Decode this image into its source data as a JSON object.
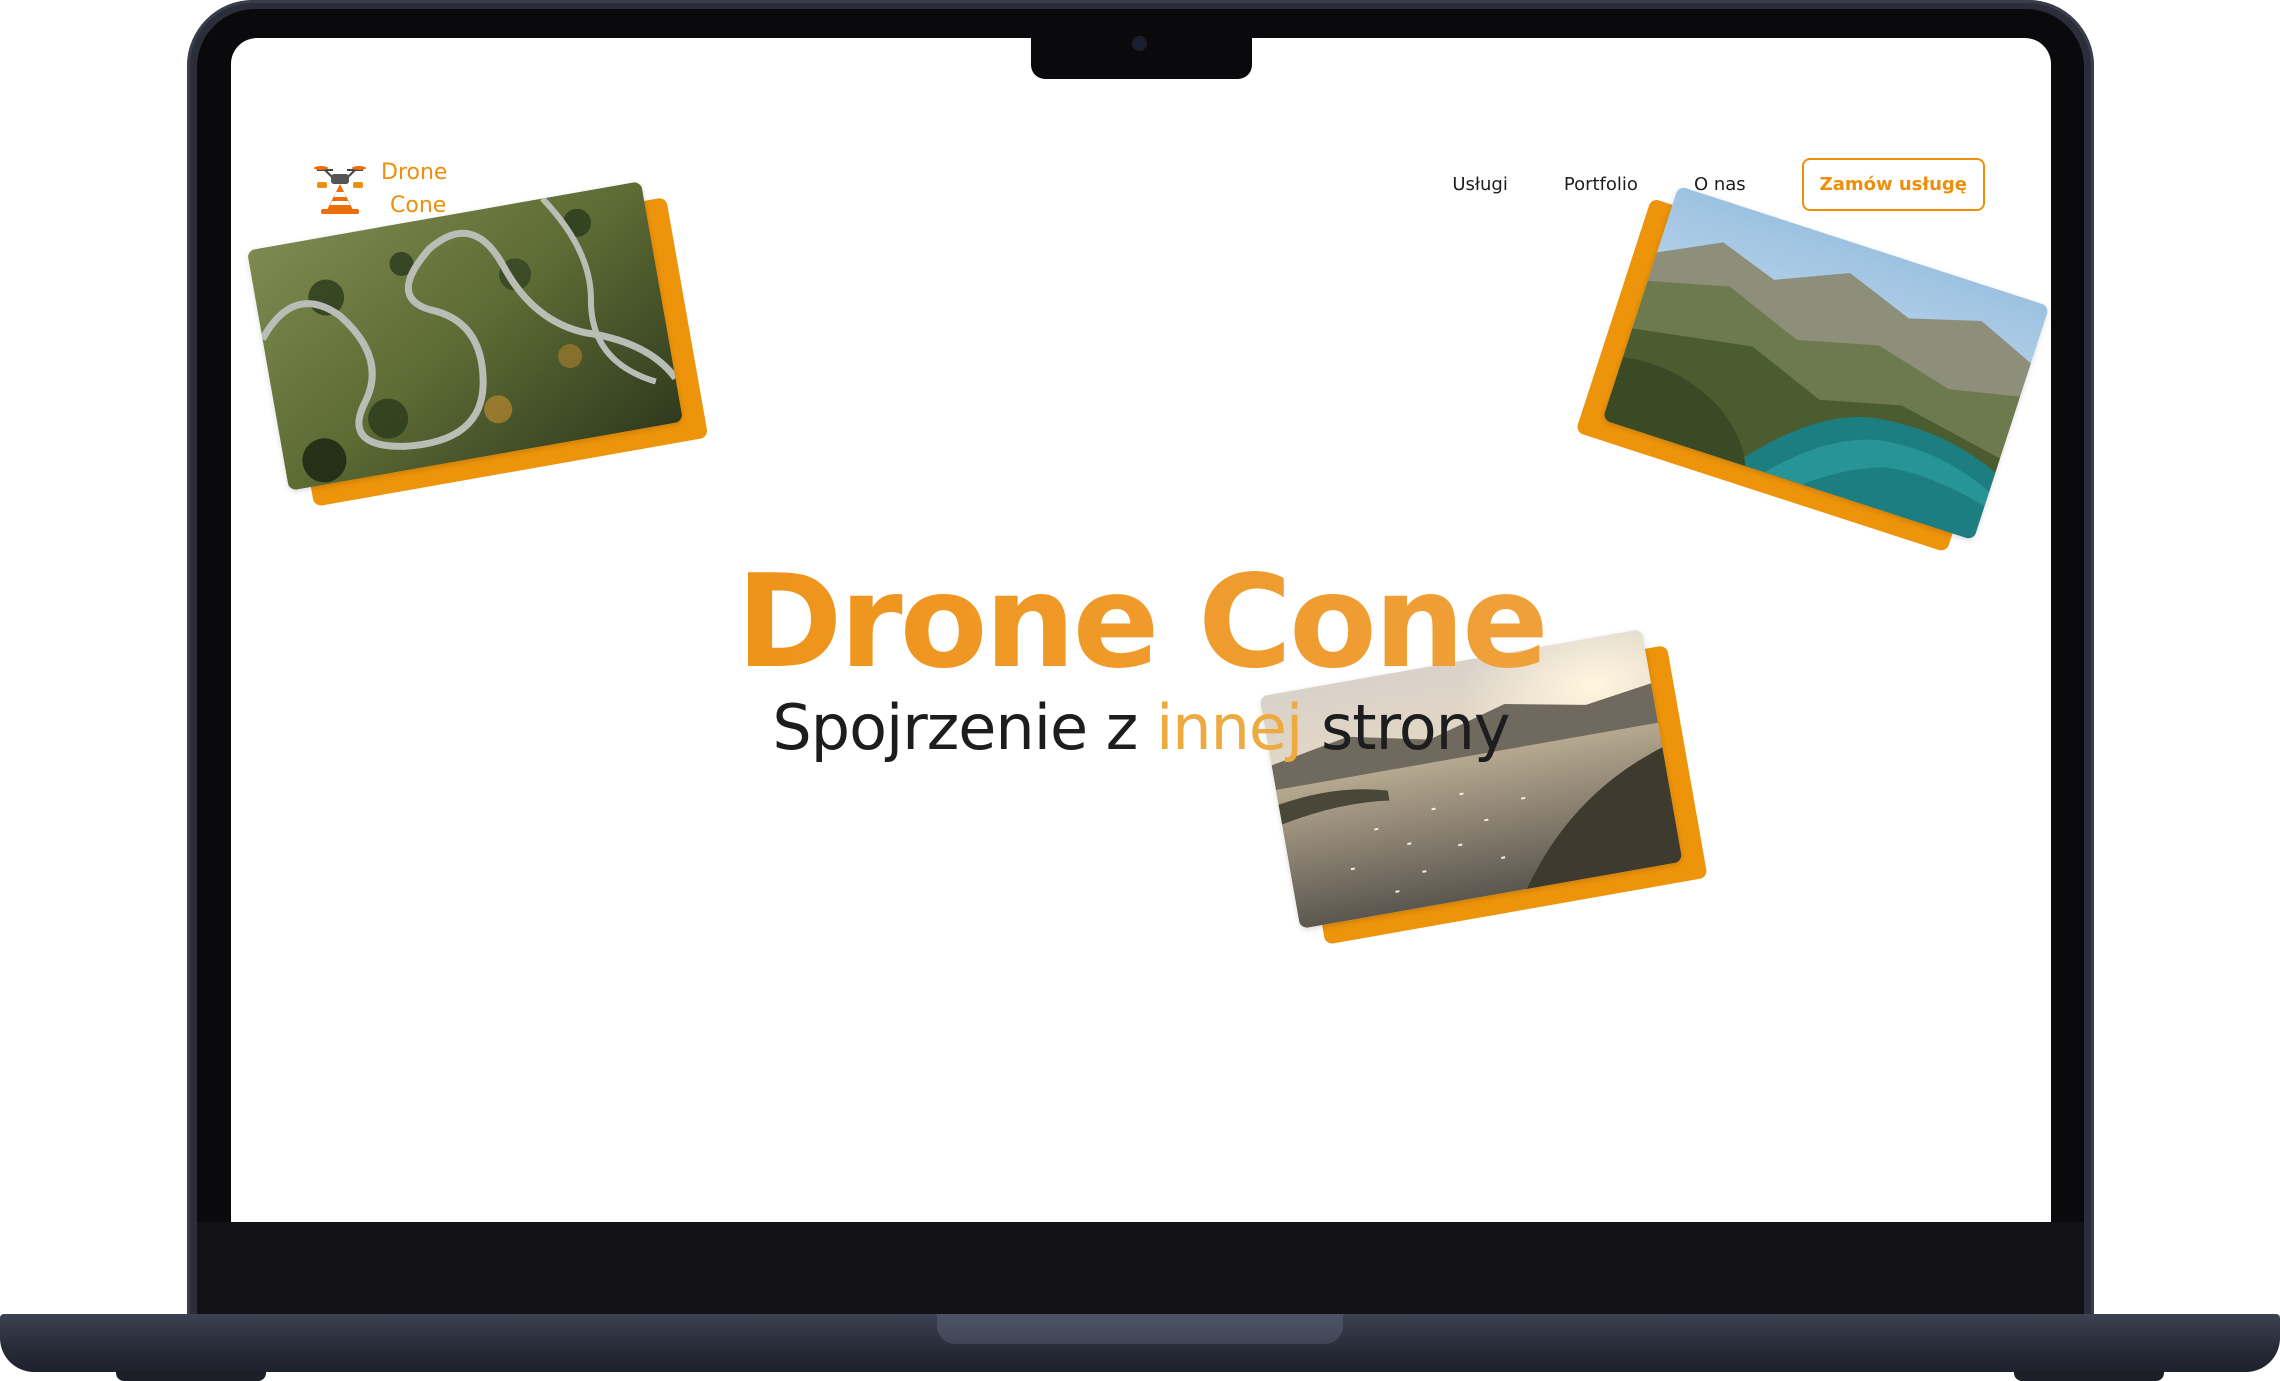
{
  "brand": {
    "line1": "Drone",
    "line2": "Cone",
    "accent_color": "#ee8f0b",
    "logo_icon": "drone-cone-logo"
  },
  "nav": {
    "items": [
      "Usługi",
      "Portfolio",
      "O nas"
    ],
    "cta_label": "Zamów usługę"
  },
  "hero": {
    "title": "Drone Cone",
    "subtitle_before": "Spojrzenie z ",
    "subtitle_accent": "innej",
    "subtitle_after": " strony"
  },
  "gallery": {
    "photos": [
      "aerial-winding-road-photo",
      "aerial-mountain-lake-photo",
      "aerial-sunset-bay-photo"
    ],
    "shadow_color": "#ee940a"
  }
}
